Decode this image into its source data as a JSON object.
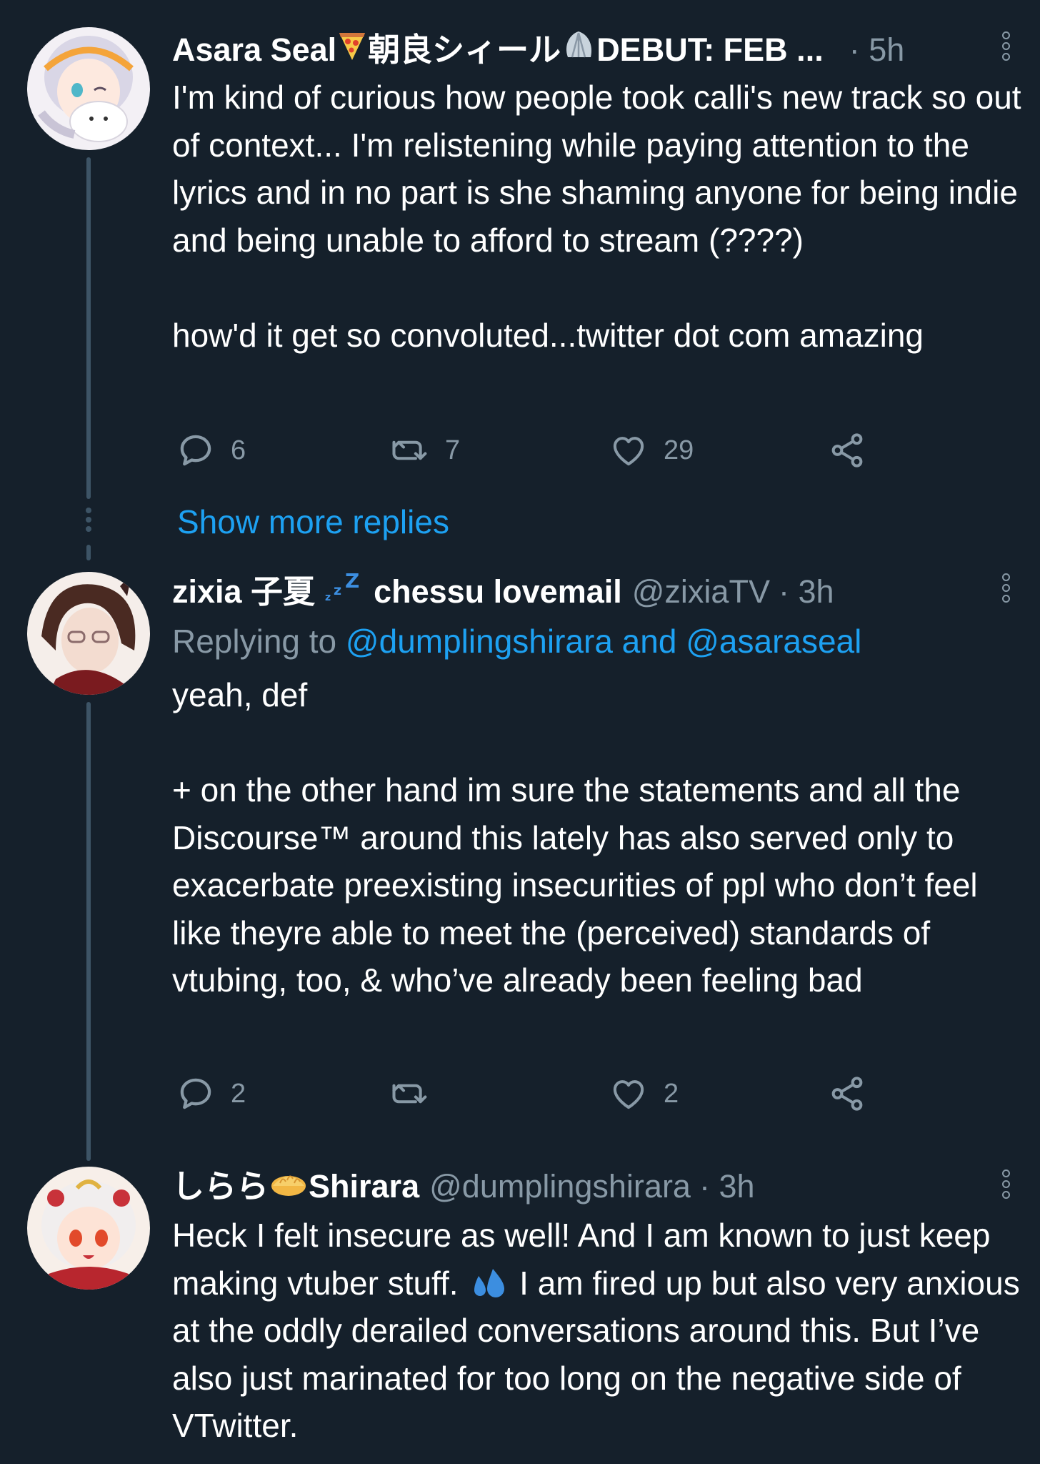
{
  "tweets": [
    {
      "display_name": "Asara Seal",
      "name_suffix": "朝良シィール",
      "name_tail": "DEBUT: FEB ...",
      "handle": "",
      "time": "· 5h",
      "body": [
        "I'm kind of curious how people took calli's new track so out of context... I'm relistening while paying attention to the lyrics and in no part is she shaming anyone for being indie and being unable to afford to stream (????)",
        "",
        "how'd it get so convoluted...twitter dot com amazing"
      ],
      "replies": "6",
      "retweets": "7",
      "likes": "29"
    },
    {
      "display_name": "zixia 子夏",
      "name_tail": "chessu lovemail",
      "handle": "@zixiaTV",
      "time": "· 3h",
      "replying_prefix": "Replying to",
      "replying_to": "@dumplingshirara and @asaraseal",
      "body": [
        "yeah, def",
        "",
        "+ on the other hand im sure the statements and all the Discourse™ around this lately has also served only to exacerbate preexisting insecurities of ppl who don’t feel like theyre able to meet the (perceived) standards of vtubing, too, & who’ve already been feeling bad"
      ],
      "replies": "2",
      "retweets": "",
      "likes": "2"
    },
    {
      "display_name": "しらら",
      "name_tail": "Shirara",
      "handle": "@dumplingshirara",
      "time": "· 3h",
      "body_before_emoji": "Heck I felt insecure as well! And I am known to just keep making vtuber stuff. ",
      "body_after_emoji": " I am fired up but also very anxious at the oddly derailed conversations around this. But I’ve also just marinated for too long on the negative side of VTwitter."
    }
  ],
  "show_more_replies": "Show more replies",
  "icons": {
    "reply": "reply-icon",
    "retweet": "retweet-icon",
    "like": "heart-icon",
    "share": "share-icon",
    "more": "more-vertical-icon",
    "pizza": "pizza-emoji",
    "shell": "shell-emoji",
    "sleep": "zzz-emoji",
    "dumpling": "dumpling-emoji",
    "sweat": "sweat-droplets-emoji"
  },
  "colors": {
    "background": "#15202b",
    "text": "#ffffff",
    "muted": "#8899a6",
    "link": "#1da1f2",
    "thread_line": "#3d5466"
  }
}
